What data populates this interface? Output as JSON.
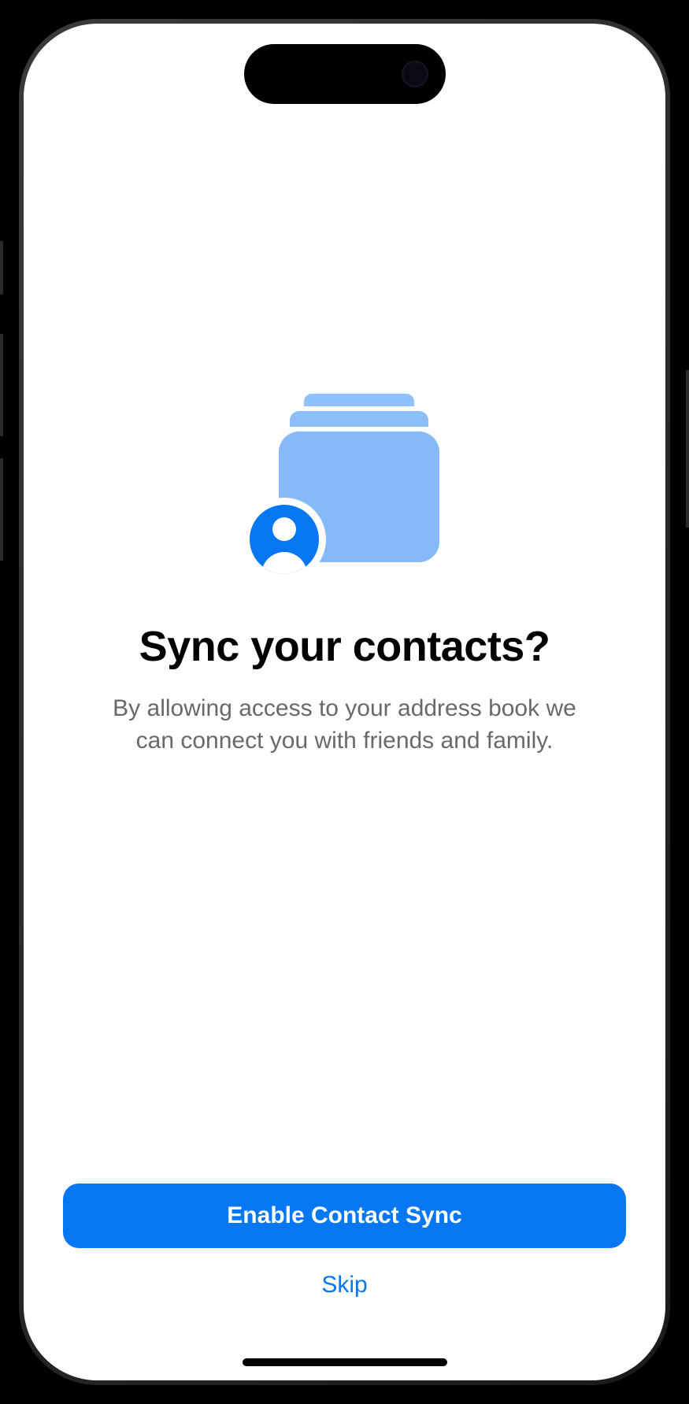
{
  "title": "Sync your contacts?",
  "description": "By allowing access to your address book we can connect you with friends and family.",
  "actions": {
    "primary_label": "Enable Contact Sync",
    "secondary_label": "Skip"
  }
}
